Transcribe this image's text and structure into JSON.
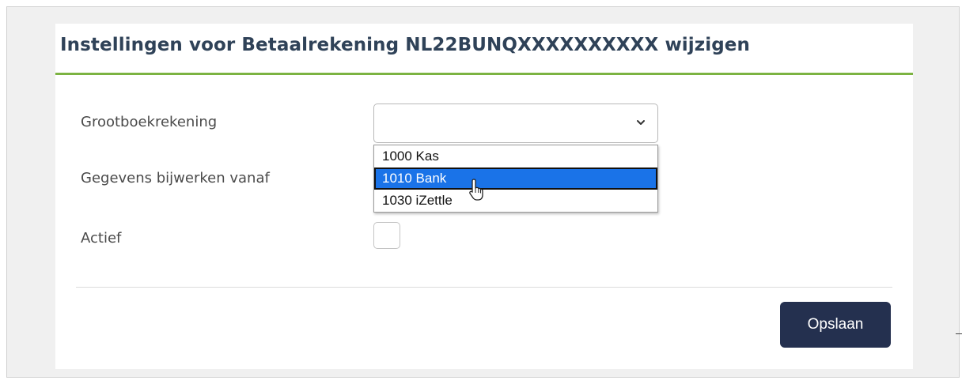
{
  "dialog": {
    "title": "Instellingen voor Betaalrekening NL22BUNQXXXXXXXXXX wijzigen",
    "accent_color": "#7cb342",
    "title_color": "#2f4258"
  },
  "form": {
    "ledger_label": "Grootboekrekening",
    "update_from_label": "Gegevens bijwerken vanaf",
    "active_label": "Actief",
    "ledger_select": {
      "value": "",
      "options": [
        {
          "label": "1000 Kas",
          "state": "normal"
        },
        {
          "label": "1010 Bank",
          "state": "highlighted"
        },
        {
          "label": "1030 iZettle",
          "state": "normal"
        }
      ]
    },
    "active_checked": false
  },
  "actions": {
    "save_label": "Opslaan",
    "save_color": "#24304f"
  },
  "icons": {
    "select_chevron": "chevron-down-icon",
    "pointer": "hand-pointer-cursor-icon"
  }
}
